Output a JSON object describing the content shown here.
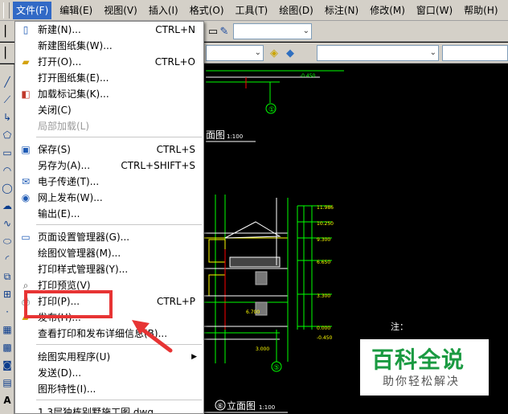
{
  "menubar": {
    "items": [
      "文件(F)",
      "编辑(E)",
      "视图(V)",
      "插入(I)",
      "格式(O)",
      "工具(T)",
      "绘图(D)",
      "标注(N)",
      "修改(M)",
      "窗口(W)",
      "帮助(H)"
    ]
  },
  "file_menu": {
    "items": [
      {
        "label": "新建(N)...",
        "shortcut": "CTRL+N",
        "icon": "new-file-icon"
      },
      {
        "label": "新建图纸集(W)...",
        "shortcut": "",
        "icon": ""
      },
      {
        "label": "打开(O)...",
        "shortcut": "CTRL+O",
        "icon": "open-folder-icon"
      },
      {
        "label": "打开图纸集(E)...",
        "shortcut": "",
        "icon": ""
      },
      {
        "label": "加载标记集(K)...",
        "shortcut": "",
        "icon": "markup-icon"
      },
      {
        "label": "关闭(C)",
        "shortcut": "",
        "icon": ""
      },
      {
        "label": "局部加载(L)",
        "shortcut": "",
        "icon": "",
        "disabled": true
      },
      {
        "label": "保存(S)",
        "shortcut": "CTRL+S",
        "icon": "save-icon"
      },
      {
        "label": "另存为(A)...",
        "shortcut": "CTRL+SHIFT+S",
        "icon": ""
      },
      {
        "label": "电子传递(T)...",
        "shortcut": "",
        "icon": "etransmit-icon"
      },
      {
        "label": "网上发布(W)...",
        "shortcut": "",
        "icon": "publish-web-icon"
      },
      {
        "label": "输出(E)...",
        "shortcut": "",
        "icon": ""
      },
      {
        "label": "页面设置管理器(G)...",
        "shortcut": "",
        "icon": "page-setup-icon"
      },
      {
        "label": "绘图仪管理器(M)...",
        "shortcut": "",
        "icon": ""
      },
      {
        "label": "打印样式管理器(Y)...",
        "shortcut": "",
        "icon": ""
      },
      {
        "label": "打印预览(V)",
        "shortcut": "",
        "icon": "print-preview-icon"
      },
      {
        "label": "打印(P)...",
        "shortcut": "CTRL+P",
        "icon": "print-icon"
      },
      {
        "label": "发布(H)...",
        "shortcut": "",
        "icon": "publish-icon"
      },
      {
        "label": "查看打印和发布详细信息(B)...",
        "shortcut": "",
        "icon": ""
      },
      {
        "label": "绘图实用程序(U)",
        "shortcut": "",
        "icon": "",
        "submenu": true
      },
      {
        "label": "发送(D)...",
        "shortcut": "",
        "icon": ""
      },
      {
        "label": "图形特性(I)...",
        "shortcut": "",
        "icon": ""
      },
      {
        "label": "1 3层独栋别墅施工图.dwg",
        "shortcut": "",
        "icon": ""
      }
    ]
  },
  "drawing": {
    "view_title_1": "面图",
    "view_scale_1": "1:100",
    "view_title_2": "立面图",
    "view_scale_2": "1:100",
    "axis_mark_1": "①",
    "axis_mark_2": "⑤",
    "axis_mark_3": "⑥",
    "elevations": [
      "11.986",
      "10.250",
      "9.300",
      "6.650",
      "3.300",
      "0.000",
      "-0.450"
    ],
    "elev_left": [
      "6.700",
      "3.000"
    ],
    "note_label": "注：",
    "top_elev": "-0.450"
  },
  "watermark": {
    "title": "百科全说",
    "subtitle": "助你轻松解决"
  },
  "colors": {
    "menu_highlight": "#3169c6",
    "annotation_red": "#e73434",
    "watermark_green": "#1a9a41",
    "cad_green": "#00ff00",
    "cad_yellow": "#ffff00"
  }
}
